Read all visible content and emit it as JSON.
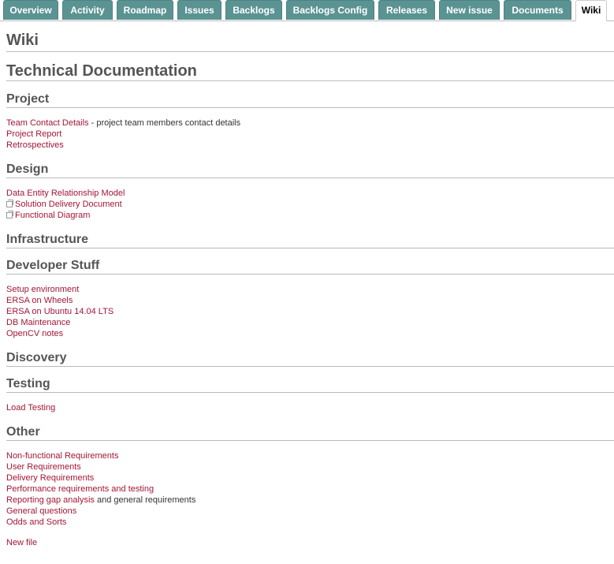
{
  "tabs": [
    "Overview",
    "Activity",
    "Roadmap",
    "Issues",
    "Backlogs",
    "Backlogs Config",
    "Releases",
    "New issue",
    "Documents",
    "Wiki"
  ],
  "page_title": "Wiki",
  "doc_title": "Technical Documentation",
  "sections": {
    "project": {
      "title": "Project",
      "team_contact": "Team Contact Details",
      "team_contact_desc": " - project team members contact details",
      "project_report": "Project Report",
      "retrospectives": "Retrospectives"
    },
    "design": {
      "title": "Design",
      "data_entity": "Data Entity Relationship Model",
      "solution_delivery": "Solution Delivery Document",
      "functional_diagram": "Functional Diagram"
    },
    "infrastructure": {
      "title": "Infrastructure"
    },
    "developer": {
      "title": "Developer Stuff",
      "setup_env": "Setup environment",
      "ersa_wheels": "ERSA on Wheels",
      "ersa_ubuntu": "ERSA on Ubuntu 14.04 LTS",
      "db_maintenance": "DB Maintenance",
      "opencv": "OpenCV notes"
    },
    "discovery": {
      "title": "Discovery"
    },
    "testing": {
      "title": "Testing",
      "load_testing": "Load Testing"
    },
    "other": {
      "title": "Other",
      "nonfunctional": "Non-functional Requirements",
      "user_req": "User Requirements",
      "delivery_req": "Delivery Requirements",
      "performance": "Performance requirements and testing",
      "reporting_gap": "Reporting gap analysis",
      "reporting_gap_suffix": " and general requirements",
      "general_questions": "General questions",
      "odds_sorts": "Odds and Sorts"
    }
  },
  "new_file": "New file",
  "colors": {
    "tab_bg": "#5b9393",
    "link": "#a31636",
    "heading": "#555555"
  }
}
